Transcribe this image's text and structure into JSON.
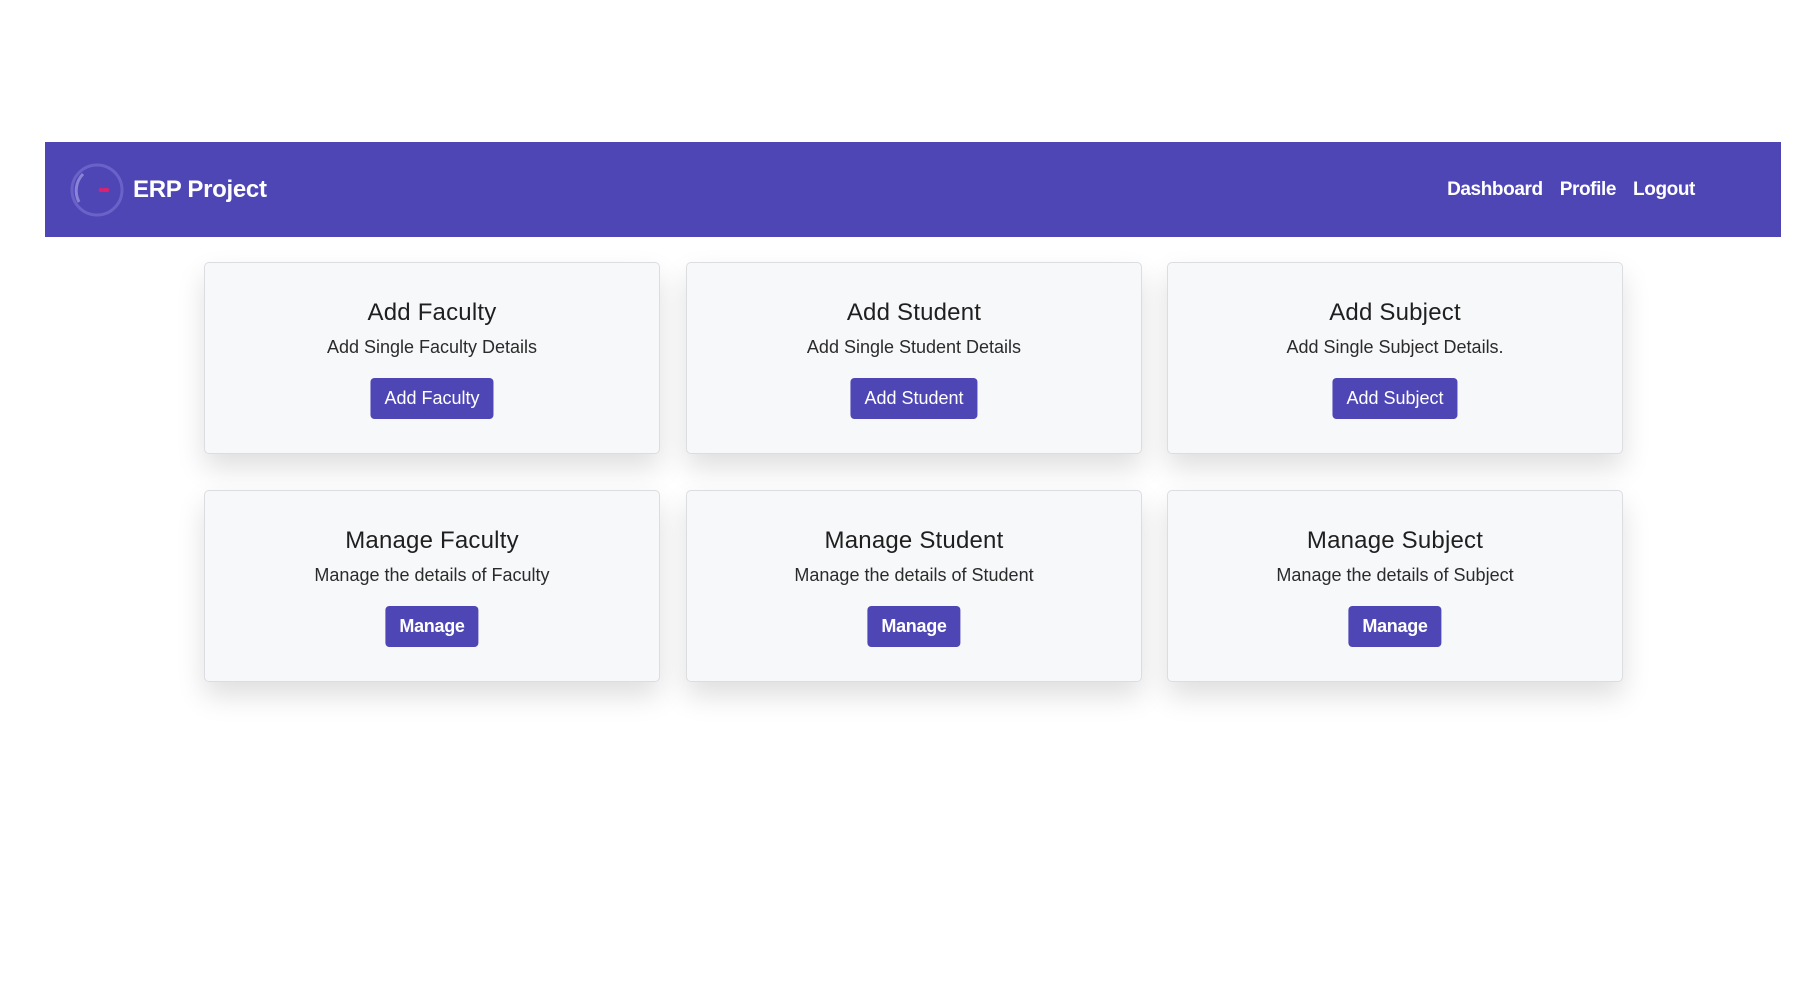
{
  "header": {
    "brand": "ERP Project",
    "logo_icon": "erp-logo-icon",
    "background_color": "#4f46b6",
    "nav": [
      {
        "label": "Dashboard"
      },
      {
        "label": "Profile"
      },
      {
        "label": "Logout"
      }
    ]
  },
  "cards": [
    {
      "title": "Add Faculty",
      "description": "Add Single Faculty Details",
      "button": "Add Faculty"
    },
    {
      "title": "Add Student",
      "description": "Add Single Student Details",
      "button": "Add Student"
    },
    {
      "title": "Add Subject",
      "description": "Add Single Subject Details.",
      "button": "Add Subject"
    },
    {
      "title": "Manage Faculty",
      "description": "Manage the details of Faculty",
      "button": "Manage"
    },
    {
      "title": "Manage Student",
      "description": "Manage the details of Student",
      "button": "Manage"
    },
    {
      "title": "Manage Subject",
      "description": "Manage the details of Subject",
      "button": "Manage"
    }
  ],
  "colors": {
    "accent": "#4f46b6",
    "card_background": "#f7f8fa",
    "logo_mark": "#e0206e"
  }
}
